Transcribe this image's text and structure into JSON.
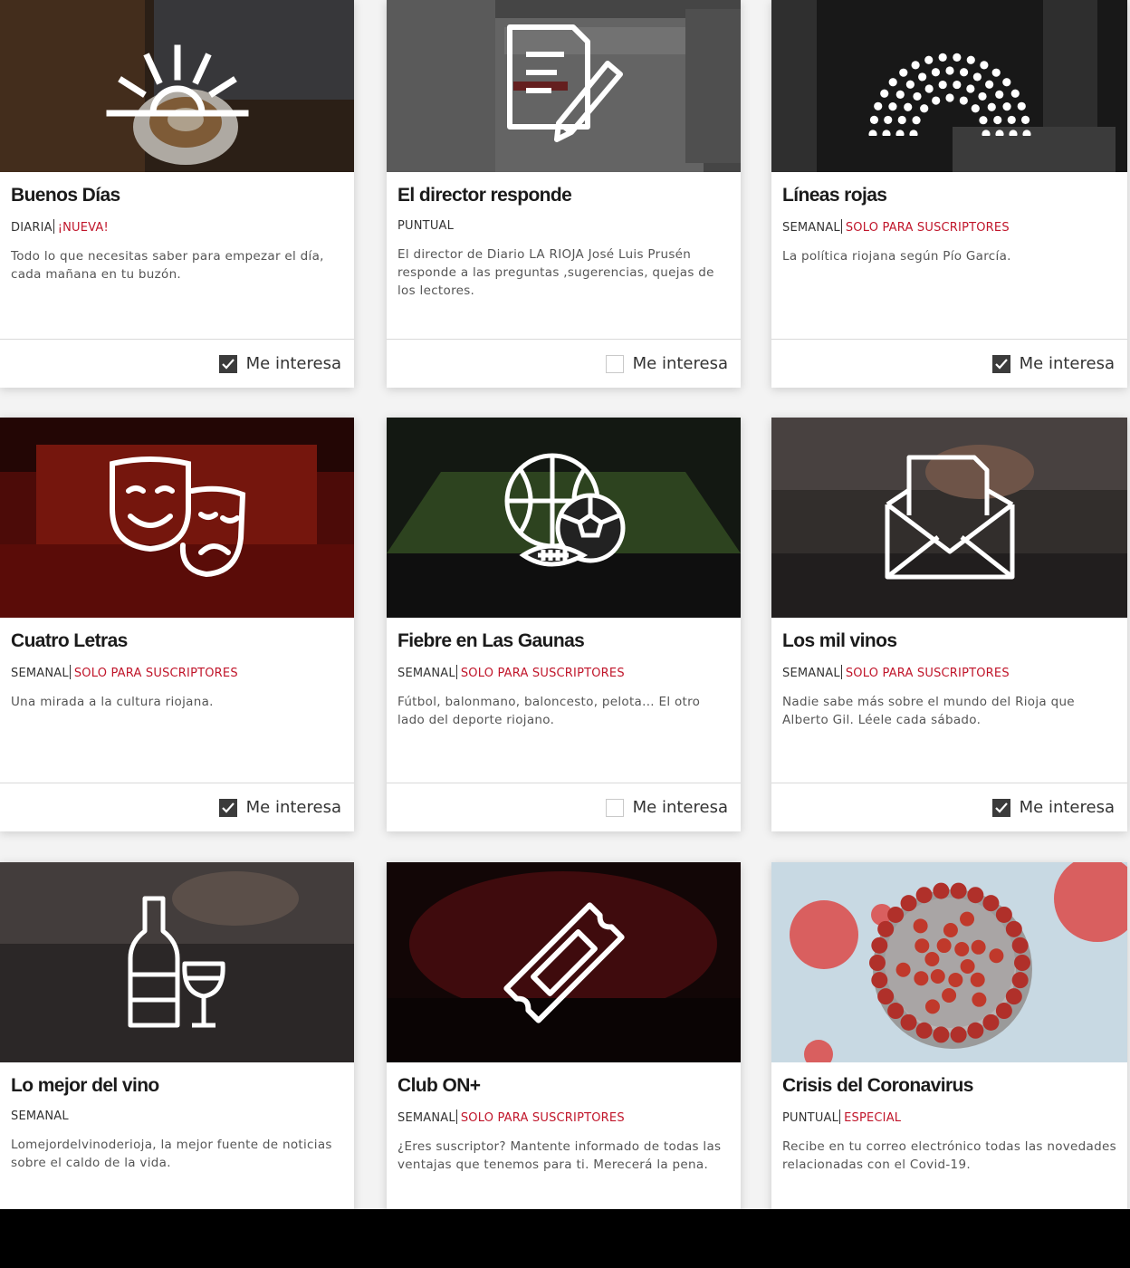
{
  "cards": [
    {
      "title": "Buenos Días",
      "frequency": "DIARIA",
      "tag": "¡NUEVA!",
      "description": "Todo lo que necesitas saber para empezar el día, cada mañana en tu buzón.",
      "checkbox_label": "Me interesa",
      "checked": true,
      "icon": "sunrise-icon"
    },
    {
      "title": "El director responde",
      "frequency": "PUNTUAL",
      "tag": "",
      "description": "El director de Diario LA RIOJA José Luis Prusén responde a las preguntas ,sugerencias, quejas de los lectores.",
      "checkbox_label": "Me interesa",
      "checked": false,
      "icon": "document-pen-icon"
    },
    {
      "title": "Líneas rojas",
      "frequency": "SEMANAL",
      "tag": "SOLO PARA SUSCRIPTORES",
      "description": "La política riojana según Pío García.",
      "checkbox_label": "Me interesa",
      "checked": true,
      "icon": "parliament-seats-icon"
    },
    {
      "title": "Cuatro Letras",
      "frequency": "SEMANAL",
      "tag": "SOLO PARA SUSCRIPTORES",
      "description": "Una mirada a la cultura riojana.",
      "checkbox_label": "Me interesa",
      "checked": true,
      "icon": "theater-masks-icon"
    },
    {
      "title": "Fiebre en Las Gaunas",
      "frequency": "SEMANAL",
      "tag": "SOLO PARA SUSCRIPTORES",
      "description": "Fútbol, balonmano, baloncesto, pelota... El otro lado del deporte riojano.",
      "checkbox_label": "Me interesa",
      "checked": false,
      "icon": "sports-balls-icon"
    },
    {
      "title": "Los mil vinos",
      "frequency": "SEMANAL",
      "tag": "SOLO PARA SUSCRIPTORES",
      "description": "Nadie sabe más sobre el mundo del Rioja que Alberto Gil. Léele cada sábado.",
      "checkbox_label": "Me interesa",
      "checked": true,
      "icon": "envelope-icon"
    },
    {
      "title": "Lo mejor del vino",
      "frequency": "SEMANAL",
      "tag": "",
      "description": "Lomejordelvinoderioja, la mejor fuente de noticias sobre el caldo de la vida.",
      "icon": "wine-bottle-glass-icon"
    },
    {
      "title": "Club ON+",
      "frequency": "SEMANAL",
      "tag": "SOLO PARA SUSCRIPTORES",
      "description": "¿Eres suscriptor? Mantente informado de todas las ventajas que tenemos para ti. Merecerá la pena.",
      "icon": "ticket-icon"
    },
    {
      "title": "Crisis del Coronavirus",
      "frequency": "PUNTUAL",
      "tag": "ESPECIAL",
      "description": "Recibe en tu correo electrónico todas las novedades relacionadas con el Covid-19.",
      "icon": "coronavirus-icon"
    }
  ],
  "colors": {
    "accent": "#c0152a",
    "checkbox_on": "#3b3b3b"
  }
}
